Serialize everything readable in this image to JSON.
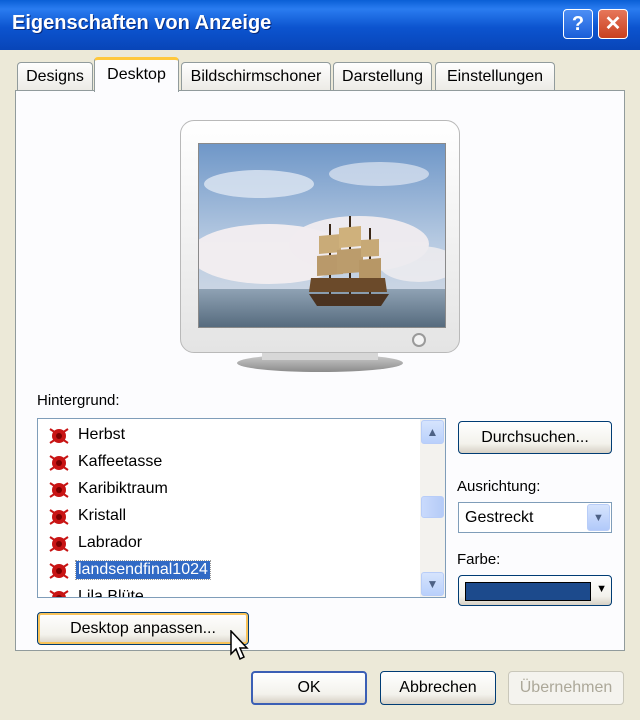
{
  "window": {
    "title": "Eigenschaften von Anzeige",
    "help_icon": "?",
    "close_icon": "✕"
  },
  "tabs": [
    {
      "label": "Designs",
      "active": false
    },
    {
      "label": "Desktop",
      "active": true
    },
    {
      "label": "Bildschirmschoner",
      "active": false
    },
    {
      "label": "Darstellung",
      "active": false
    },
    {
      "label": "Einstellungen",
      "active": false
    }
  ],
  "background": {
    "label": "Hintergrund:",
    "items": [
      {
        "label": "Herbst"
      },
      {
        "label": "Kaffeetasse"
      },
      {
        "label": "Karibiktraum"
      },
      {
        "label": "Kristall"
      },
      {
        "label": "Labrador"
      },
      {
        "label": "landsendfinal1024",
        "selected": true
      },
      {
        "label": "Lila Blüte"
      }
    ],
    "item_icon": "wallpaper-file-icon"
  },
  "buttons": {
    "browse": "Durchsuchen...",
    "customize": "Desktop anpassen...",
    "ok": "OK",
    "cancel": "Abbrechen",
    "apply": "Übernehmen"
  },
  "position": {
    "label": "Ausrichtung:",
    "value": "Gestreckt"
  },
  "color": {
    "label": "Farbe:",
    "value": "#1c4a8c"
  },
  "preview": {
    "image_description_icon": "sailing-ship-wallpaper"
  }
}
